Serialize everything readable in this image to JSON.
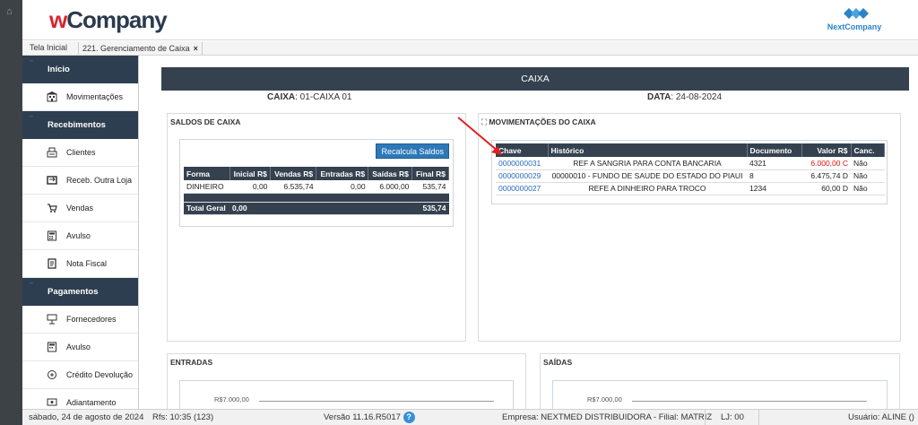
{
  "header": {
    "logo_w": "w",
    "logo_rest": "Company",
    "brand_right": "NextCompany"
  },
  "tabs": [
    {
      "label": "Tela Inicial"
    },
    {
      "label": "221. Gerenciamento de Caixa",
      "close": "×"
    }
  ],
  "sidebar": {
    "sections": [
      {
        "title": "Início",
        "items": [
          "Movimentações"
        ]
      },
      {
        "title": "Recebimentos",
        "items": [
          "Clientes",
          "Receb. Outra Loja",
          "Vendas",
          "Avulso",
          "Nota Fiscal"
        ]
      },
      {
        "title": "Pagamentos",
        "items": [
          "Fornecedores",
          "Avulso",
          "Crédito Devolução",
          "Adiantamento"
        ]
      }
    ]
  },
  "main": {
    "title": "CAIXA",
    "caixa_label": "CAIXA",
    "caixa_value": ": 01-CAIXA 01",
    "data_label": "DATA",
    "data_value": ": 24-08-2024",
    "saldos": {
      "title": "SALDOS DE CAIXA",
      "button": "Recalcula Saldos",
      "headers": [
        "Forma",
        "Inicial R$",
        "Vendas R$",
        "Entradas R$",
        "Saídas R$",
        "Final R$"
      ],
      "rows": [
        [
          "DINHEIRO",
          "0,00",
          "6.535,74",
          "0,00",
          "6.000,00",
          "535,74"
        ]
      ],
      "total": {
        "label": "Total Geral",
        "inicial": "0,00",
        "final": "535,74"
      }
    },
    "movimentacoes": {
      "title": "MOVIMENTAÇÕES DO CAIXA",
      "headers": [
        "Chave",
        "Histórico",
        "Documento",
        "Valor R$",
        "Canc."
      ],
      "rows": [
        {
          "chave": "0000000031",
          "historico": "REF A SANGRIA PARA CONTA BANCARIA",
          "documento": "4321",
          "valor": "6.000,00 C",
          "canc": "Não",
          "red": true
        },
        {
          "chave": "0000000029",
          "historico": "00000010 - FUNDO DE SAUDE DO ESTADO DO PIAUI",
          "documento": "8",
          "valor": "6.475,74 D",
          "canc": "Não",
          "red": false
        },
        {
          "chave": "0000000027",
          "historico": "REFE A DINHEIRO PARA TROCO",
          "documento": "1234",
          "valor": "60,00 D",
          "canc": "Não",
          "red": false
        }
      ]
    },
    "entradas": {
      "title": "ENTRADAS",
      "axis_label": "R$7.000,00"
    },
    "saidas": {
      "title": "SAÍDAS",
      "axis_label": "R$7.000,00"
    }
  },
  "status": {
    "date": "sábado, 24 de agosto de 2024",
    "rfs": "Rfs: 10:35 (123)",
    "version": "Versão 11.16.R5017",
    "help": "?",
    "empresa": "Empresa: NEXTMED DISTRIBUIDORA - Filial: MATRIZ",
    "lj": "LJ: 00",
    "usuario": "Usuário: ALINE ()"
  },
  "colors": {
    "dark": "#35414f",
    "accent": "#2d78b8",
    "red": "#d11111"
  }
}
